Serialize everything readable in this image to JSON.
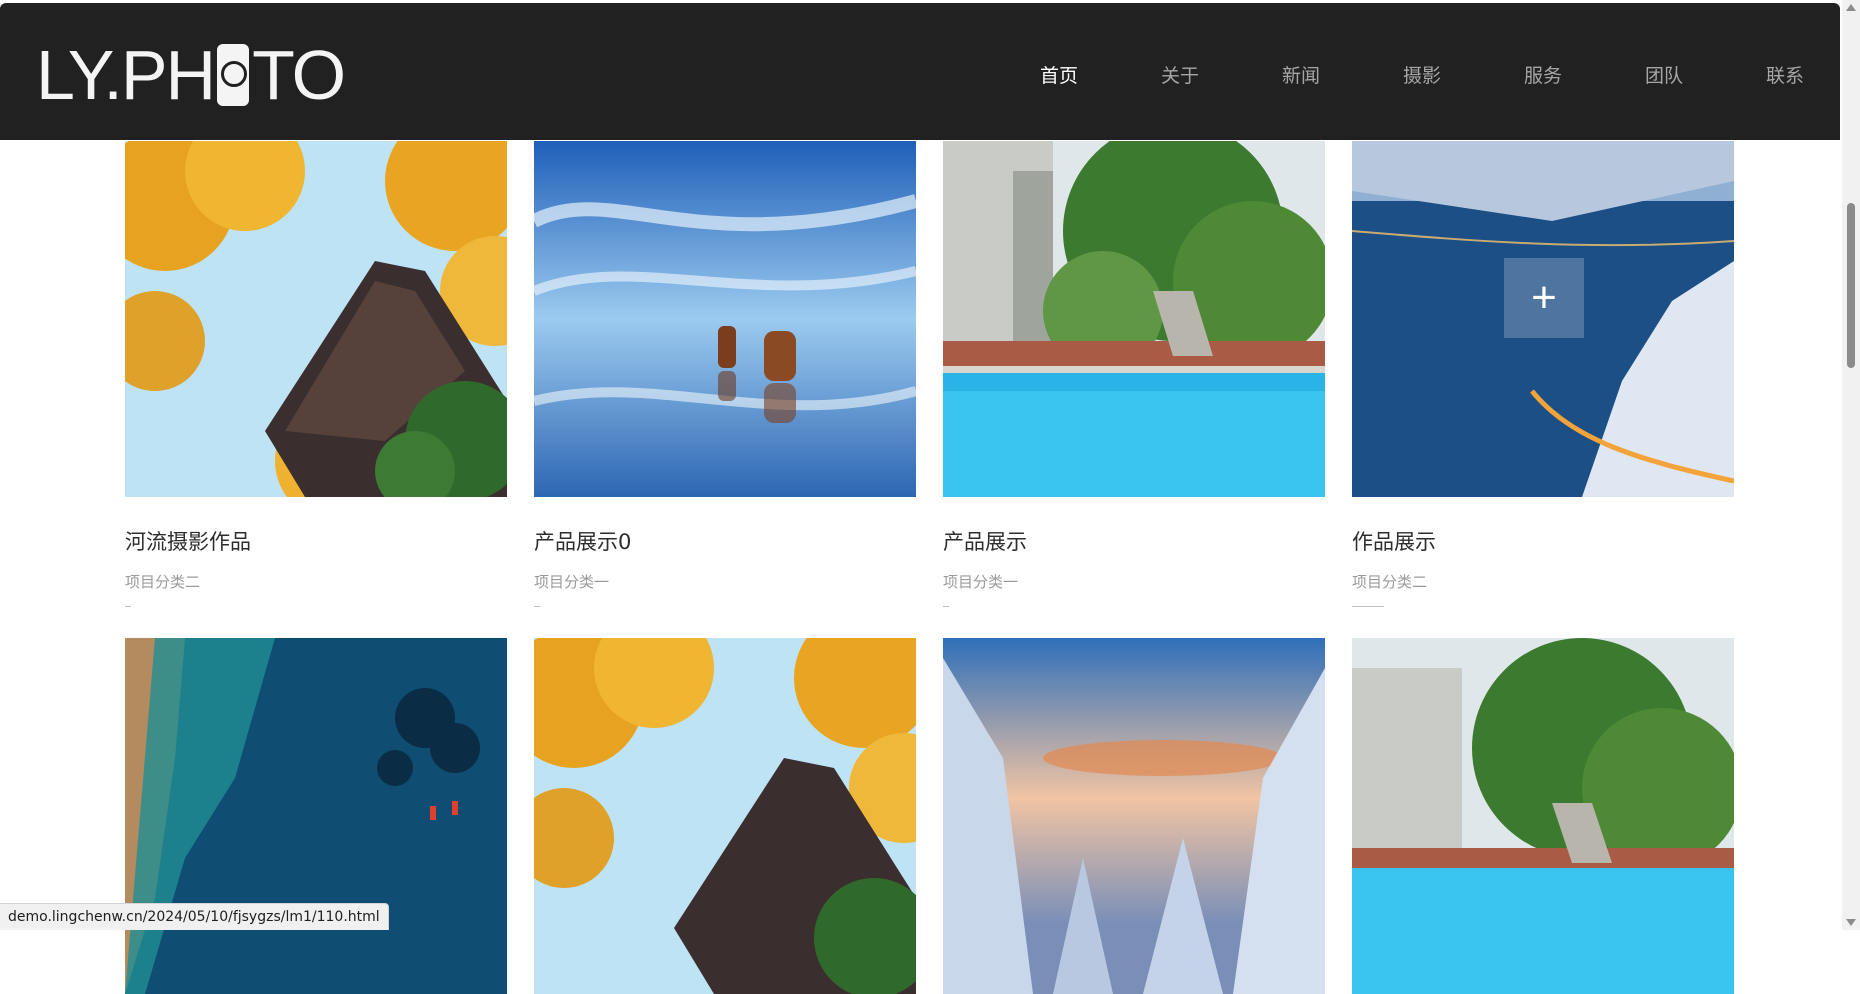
{
  "brand": {
    "logo_text_left": "LY.PH",
    "logo_text_right": "TO"
  },
  "nav": [
    {
      "label": "首页",
      "active": true
    },
    {
      "label": "关于",
      "active": false
    },
    {
      "label": "新闻",
      "active": false
    },
    {
      "label": "摄影",
      "active": false
    },
    {
      "label": "服务",
      "active": false
    },
    {
      "label": "团队",
      "active": false
    },
    {
      "label": "联系",
      "active": false
    }
  ],
  "items_row1": [
    {
      "title": "河流摄影作品",
      "category": "项目分类二"
    },
    {
      "title": "产品展示0",
      "category": "项目分类一"
    },
    {
      "title": "产品展示",
      "category": "项目分类一"
    },
    {
      "title": "作品展示",
      "category": "项目分类二"
    }
  ],
  "hover_icon": "plus-icon",
  "status_url": "demo.lingchenw.cn/2024/05/10/fjsygzs/lm1/110.html",
  "colors": {
    "header_bg": "#212121",
    "nav_active": "#ffffff",
    "nav_inactive": "#a6a6a6"
  }
}
